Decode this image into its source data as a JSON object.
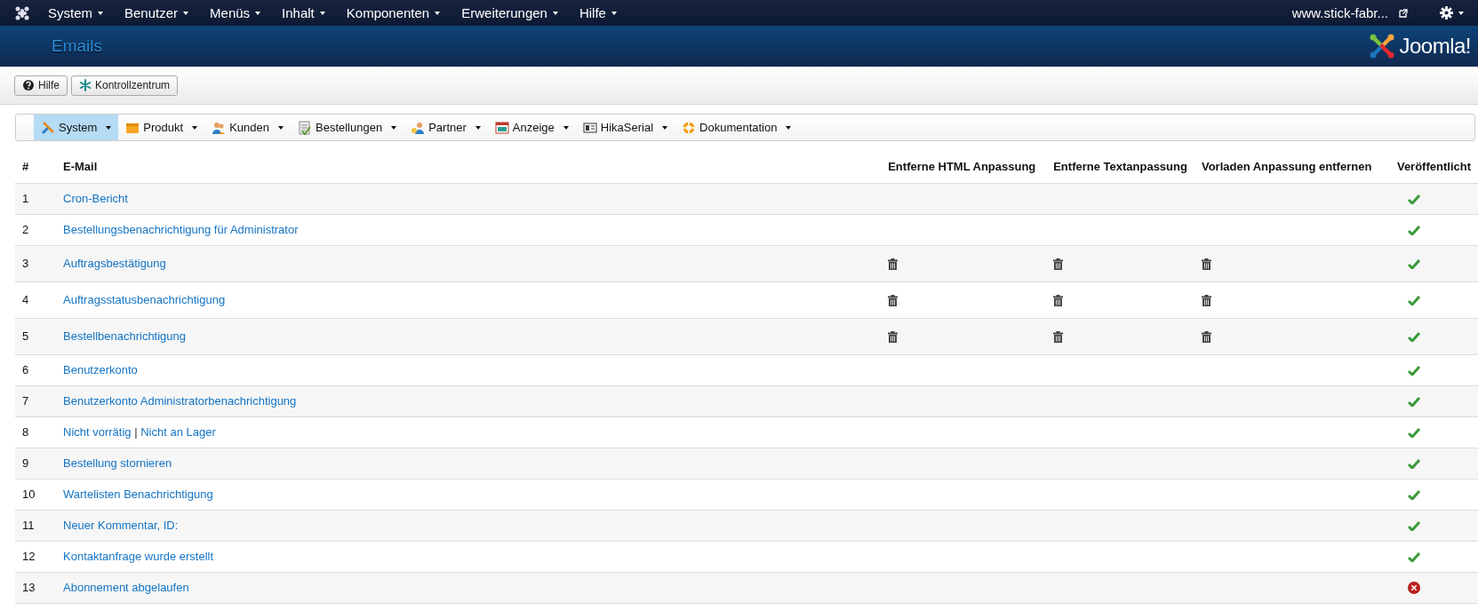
{
  "top_menu": [
    {
      "label": "System"
    },
    {
      "label": "Benutzer"
    },
    {
      "label": "Menüs"
    },
    {
      "label": "Inhalt"
    },
    {
      "label": "Komponenten"
    },
    {
      "label": "Erweiterungen"
    },
    {
      "label": "Hilfe"
    }
  ],
  "site_link": "www.stick-fabr...",
  "header": {
    "title": "Emails",
    "logo_text": "Joomla!"
  },
  "toolbar": [
    {
      "label": "Hilfe",
      "kind": "help"
    },
    {
      "label": "Kontrollzentrum",
      "kind": "control"
    }
  ],
  "submenu": [
    {
      "label": "System",
      "kind": "system",
      "selected": true
    },
    {
      "label": "Produkt",
      "kind": "product",
      "selected": false
    },
    {
      "label": "Kunden",
      "kind": "customers",
      "selected": false
    },
    {
      "label": "Bestellungen",
      "kind": "orders",
      "selected": false
    },
    {
      "label": "Partner",
      "kind": "partner",
      "selected": false
    },
    {
      "label": "Anzeige",
      "kind": "display",
      "selected": false
    },
    {
      "label": "HikaSerial",
      "kind": "serial",
      "selected": false
    },
    {
      "label": "Dokumentation",
      "kind": "docs",
      "selected": false
    }
  ],
  "table": {
    "columns": [
      "#",
      "E-Mail",
      "Entferne HTML Anpassung",
      "Entferne Textanpassung",
      "Vorladen Anpassung entfernen",
      "Veröffentlicht"
    ],
    "rows": [
      {
        "num": "1",
        "links": [
          "Cron-Bericht"
        ],
        "remove_html": false,
        "remove_text": false,
        "remove_preload": false,
        "published": true
      },
      {
        "num": "2",
        "links": [
          "Bestellungsbenachrichtigung für Administrator"
        ],
        "remove_html": false,
        "remove_text": false,
        "remove_preload": false,
        "published": true
      },
      {
        "num": "3",
        "links": [
          "Auftragsbestätigung"
        ],
        "remove_html": true,
        "remove_text": true,
        "remove_preload": true,
        "published": true
      },
      {
        "num": "4",
        "links": [
          "Auftragsstatusbenachrichtigung"
        ],
        "remove_html": true,
        "remove_text": true,
        "remove_preload": true,
        "published": true
      },
      {
        "num": "5",
        "links": [
          "Bestellbenachrichtigung"
        ],
        "remove_html": true,
        "remove_text": true,
        "remove_preload": true,
        "published": true
      },
      {
        "num": "6",
        "links": [
          "Benutzerkonto"
        ],
        "remove_html": false,
        "remove_text": false,
        "remove_preload": false,
        "published": true
      },
      {
        "num": "7",
        "links": [
          "Benutzerkonto Administratorbenachrichtigung"
        ],
        "remove_html": false,
        "remove_text": false,
        "remove_preload": false,
        "published": true
      },
      {
        "num": "8",
        "links": [
          "Nicht vorrätig",
          "Nicht an Lager"
        ],
        "separator": "|",
        "remove_html": false,
        "remove_text": false,
        "remove_preload": false,
        "published": true
      },
      {
        "num": "9",
        "links": [
          "Bestellung stornieren"
        ],
        "remove_html": false,
        "remove_text": false,
        "remove_preload": false,
        "published": true
      },
      {
        "num": "10",
        "links": [
          "Wartelisten Benachrichtigung"
        ],
        "remove_html": false,
        "remove_text": false,
        "remove_preload": false,
        "published": true
      },
      {
        "num": "11",
        "links": [
          "Neuer Kommentar, ID:"
        ],
        "remove_html": false,
        "remove_text": false,
        "remove_preload": false,
        "published": true
      },
      {
        "num": "12",
        "links": [
          "Kontaktanfrage wurde erstellt"
        ],
        "remove_html": false,
        "remove_text": false,
        "remove_preload": false,
        "published": true
      },
      {
        "num": "13",
        "links": [
          "Abonnement abgelaufen"
        ],
        "remove_html": false,
        "remove_text": false,
        "remove_preload": false,
        "published": false
      }
    ]
  }
}
